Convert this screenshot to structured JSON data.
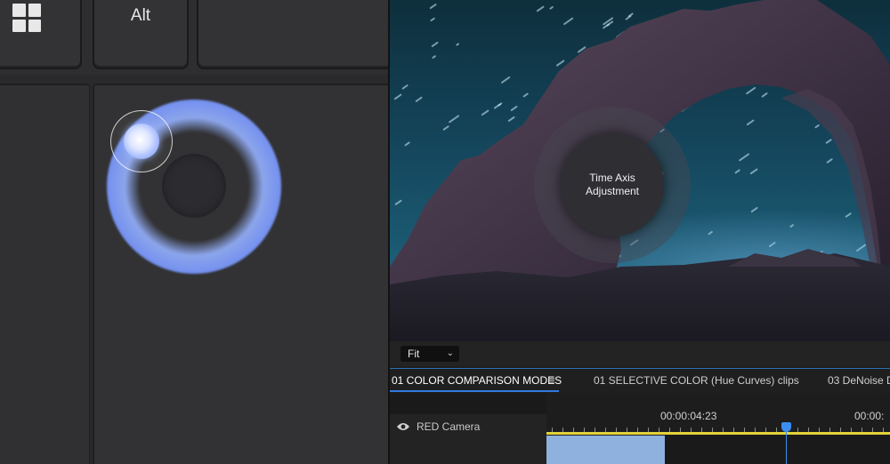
{
  "keyboard": {
    "windows_key_icon": "windows-logo-icon",
    "alt_key_label": "Alt"
  },
  "touchpad": {
    "gesture": "circular-scroll"
  },
  "viewer": {
    "dial_label": "Time Axis Adjustment",
    "fit_value": "Fit"
  },
  "tabs": [
    {
      "label": "01 COLOR COMPARISON MODES"
    },
    {
      "label": "01 SELECTIVE COLOR (Hue Curves) clips"
    },
    {
      "label": "03 DeNoise D"
    }
  ],
  "timeline": {
    "track_name": "RED Camera",
    "timecode_1": "00:00:04:23",
    "timecode_2": "00:00:"
  },
  "colors": {
    "accent_blue": "#2f7ae0",
    "work_area_yellow": "#e3d33a",
    "clip_blue": "#8fb1de",
    "touch_glow": "#8ea8ff"
  }
}
